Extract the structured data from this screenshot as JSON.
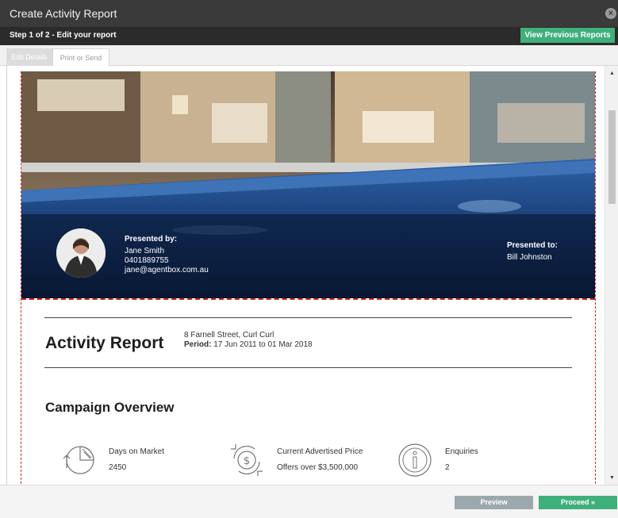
{
  "window": {
    "title": "Create Activity Report"
  },
  "stepbar": {
    "step_text": "Step 1 of 2 - Edit your report",
    "view_previous_label": "View Previous Reports"
  },
  "tabs": [
    {
      "label": "Edit Details",
      "active": true
    },
    {
      "label": "Print or Send",
      "active": false
    }
  ],
  "hero": {
    "presented_by_heading": "Presented by:",
    "agent_name": "Jane Smith",
    "agent_phone": "0401889755",
    "agent_email": "jane@agentbox.com.au",
    "presented_to_heading": "Presented to:",
    "client_name": "Bill Johnston"
  },
  "report": {
    "title": "Activity Report",
    "address": "8 Farnell Street, Curl Curl",
    "period_label": "Period:",
    "period_value": "17 Jun 2011 to 01 Mar 2018"
  },
  "campaign": {
    "heading": "Campaign Overview",
    "stats": [
      {
        "label": "Days on Market",
        "value": "2450",
        "icon": "pie-chart-icon"
      },
      {
        "label": "Current Advertised Price",
        "value": "Offers over $3,500,000",
        "icon": "dollar-cycle-icon"
      },
      {
        "label": "Enquiries",
        "value": "2",
        "icon": "info-icon"
      }
    ]
  },
  "footer": {
    "preview_label": "Preview",
    "proceed_label": "Proceed »"
  },
  "colors": {
    "titlebar": "#3a3a3a",
    "stepbar": "#2b2b2b",
    "accent_green": "#3fb07b",
    "preview_grey": "#9ba8ad",
    "guide_red": "#cc2222"
  }
}
